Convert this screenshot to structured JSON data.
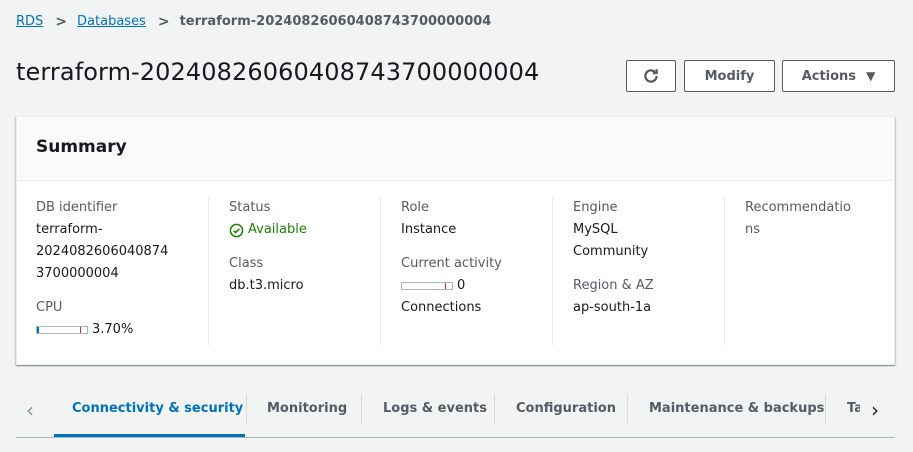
{
  "breadcrumb": {
    "items": [
      "RDS",
      "Databases"
    ],
    "current": "terraform-20240826060408743700000004",
    "separator": ">"
  },
  "page": {
    "title": "terraform-20240826060408743700000004"
  },
  "actions": {
    "refresh_icon": "refresh-icon",
    "modify_label": "Modify",
    "actions_label": "Actions",
    "actions_caret": "▼"
  },
  "summary": {
    "title": "Summary",
    "db_identifier": {
      "label": "DB identifier",
      "value_lines": [
        "terraform-",
        "2024082606040874",
        "3700000004"
      ]
    },
    "cpu": {
      "label": "CPU",
      "value": "3.70%",
      "fraction": 0.037
    },
    "status": {
      "label": "Status",
      "value": "Available",
      "color": "#1d8102"
    },
    "class": {
      "label": "Class",
      "value": "db.t3.micro"
    },
    "role": {
      "label": "Role",
      "value": "Instance"
    },
    "current_activity": {
      "label": "Current activity",
      "value": "0",
      "unit": "Connections",
      "fraction": 0
    },
    "engine": {
      "label": "Engine",
      "value_lines": [
        "MySQL",
        "Community"
      ]
    },
    "region_az": {
      "label": "Region & AZ",
      "value": "ap-south-1a"
    },
    "recommendations": {
      "label_lines": [
        "Recommendatio",
        "ns"
      ]
    }
  },
  "tabs": {
    "items": [
      "Connectivity & security",
      "Monitoring",
      "Logs & events",
      "Configuration",
      "Maintenance & backups",
      "Ta"
    ],
    "active_index": 0,
    "prev_arrow": "‹",
    "next_arrow": "›"
  },
  "colors": {
    "accent": "#0073bb",
    "success": "#1d8102",
    "text": "#16191f",
    "muted": "#545b64"
  }
}
